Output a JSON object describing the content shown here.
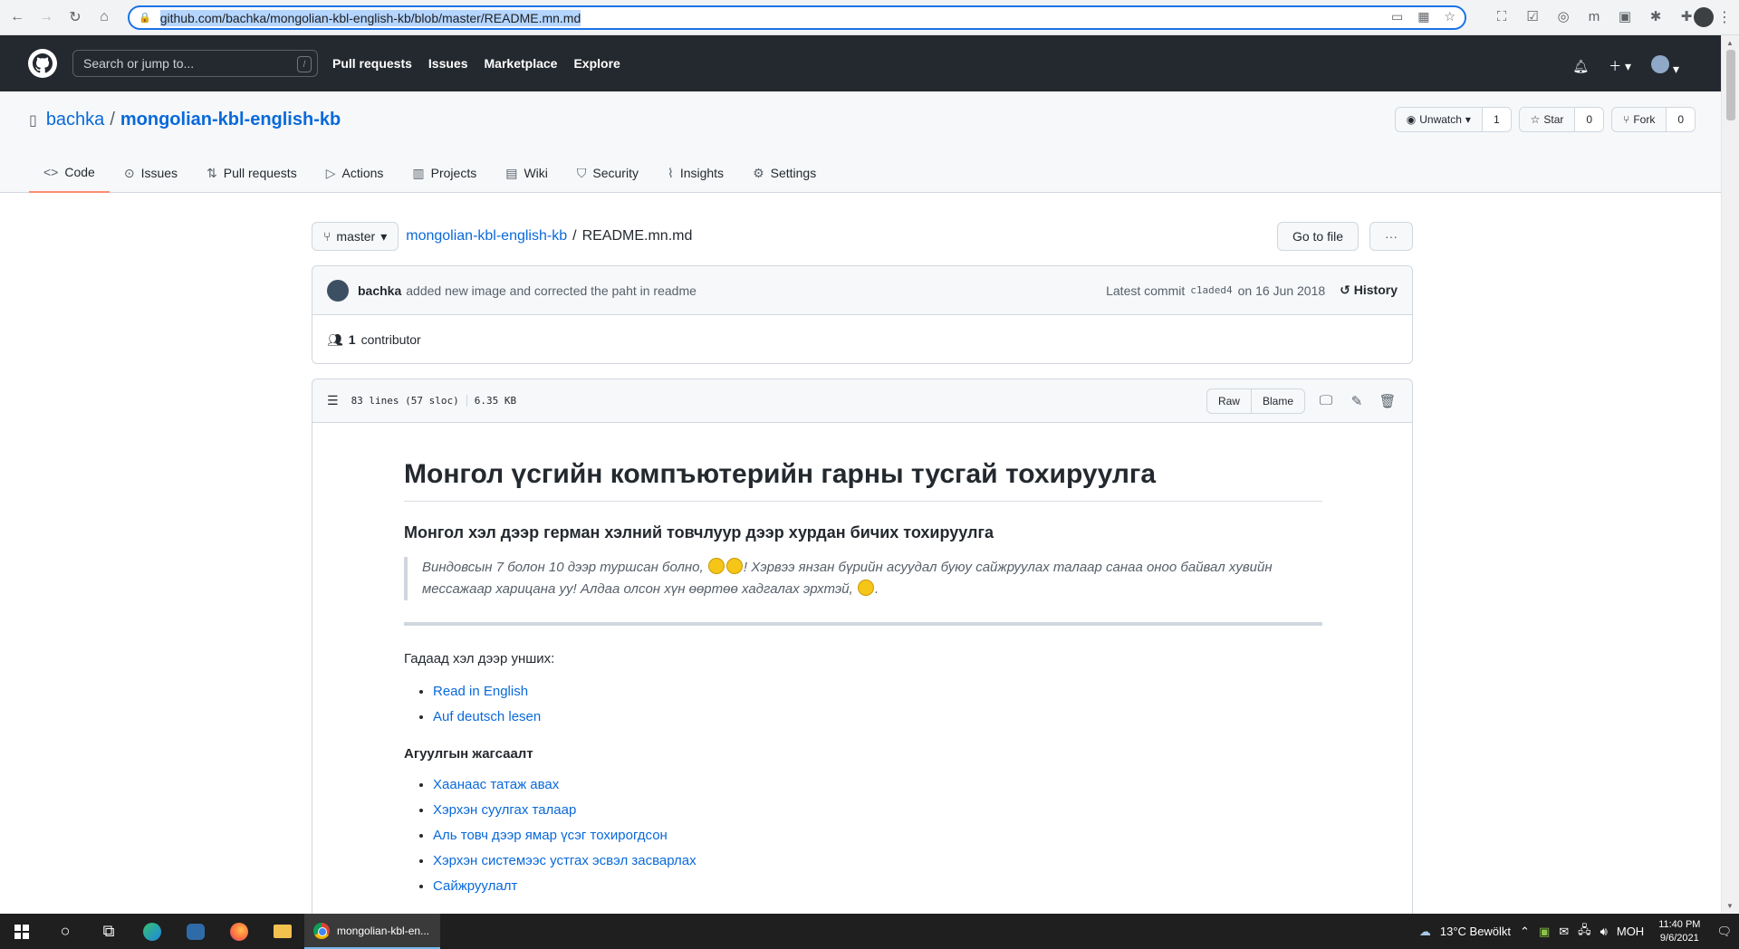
{
  "browser": {
    "url": "github.com/bachka/mongolian-kbl-english-kb/blob/master/README.mn.md"
  },
  "gh_header": {
    "search_placeholder": "Search or jump to...",
    "search_key": "/",
    "nav": [
      "Pull requests",
      "Issues",
      "Marketplace",
      "Explore"
    ]
  },
  "repo": {
    "owner": "bachka",
    "separator": "/",
    "name": "mongolian-kbl-english-kb",
    "watch_label": "Unwatch",
    "watch_count": "1",
    "star_label": "Star",
    "star_count": "0",
    "fork_label": "Fork",
    "fork_count": "0",
    "tabs": [
      {
        "label": "Code",
        "icon": "code-icon"
      },
      {
        "label": "Issues",
        "icon": "issue-icon"
      },
      {
        "label": "Pull requests",
        "icon": "pull-request-icon"
      },
      {
        "label": "Actions",
        "icon": "play-icon"
      },
      {
        "label": "Projects",
        "icon": "project-icon"
      },
      {
        "label": "Wiki",
        "icon": "book-icon"
      },
      {
        "label": "Security",
        "icon": "shield-icon"
      },
      {
        "label": "Insights",
        "icon": "graph-icon"
      },
      {
        "label": "Settings",
        "icon": "gear-icon"
      }
    ]
  },
  "file_nav": {
    "branch": "master",
    "repo_link": "mongolian-kbl-english-kb",
    "separator": "/",
    "file_name": "README.mn.md",
    "goto_label": "Go to file",
    "more_label": "···"
  },
  "commit": {
    "author": "bachka",
    "message": "added new image and corrected the paht in readme",
    "latest_label": "Latest commit",
    "sha": "c1aded4",
    "date": "on 16 Jun 2018",
    "history_label": "History",
    "contributors_count": "1",
    "contributors_label": "contributor"
  },
  "file": {
    "lines": "83 lines (57 sloc)",
    "size": "6.35 KB",
    "raw_label": "Raw",
    "blame_label": "Blame"
  },
  "markdown": {
    "h1": "Монгол үсгийн компъютерийн гарны тусгай тохируулга",
    "h3": "Монгол хэл дээр герман хэлний товчлуур дээр хурдан бичих тохируулга",
    "quote_part1": "Виндовсын 7 болон 10 дээр туршсан болно, ",
    "quote_part2": "! Хэрвээ янзан бүрийн асуудал буюу сайжруулах талаар санаа оноо байвал хувийн мессажаар харицана уу! Алдаа олсон хүн өөртөө хадгалах эрхтэй, ",
    "quote_end": ".",
    "read_other": "Гадаад хэл дээр унших:",
    "lang_links": [
      "Read in English",
      "Auf deutsch lesen"
    ],
    "toc_title": "Агуулгын жагсаалт",
    "toc": [
      "Хаанаас татаж авах",
      "Хэрхэн суулгах талаар",
      "Аль товч дээр ямар үсэг тохирогдсон",
      "Хэрхэн системээс устгах эсвэл засварлах",
      "Сайжруулалт"
    ]
  },
  "taskbar": {
    "app_label": "mongolian-kbl-en...",
    "weather": "13°C  Bewölkt",
    "lang": "MOH",
    "time": "11:40 PM",
    "date": "9/6/2021"
  }
}
